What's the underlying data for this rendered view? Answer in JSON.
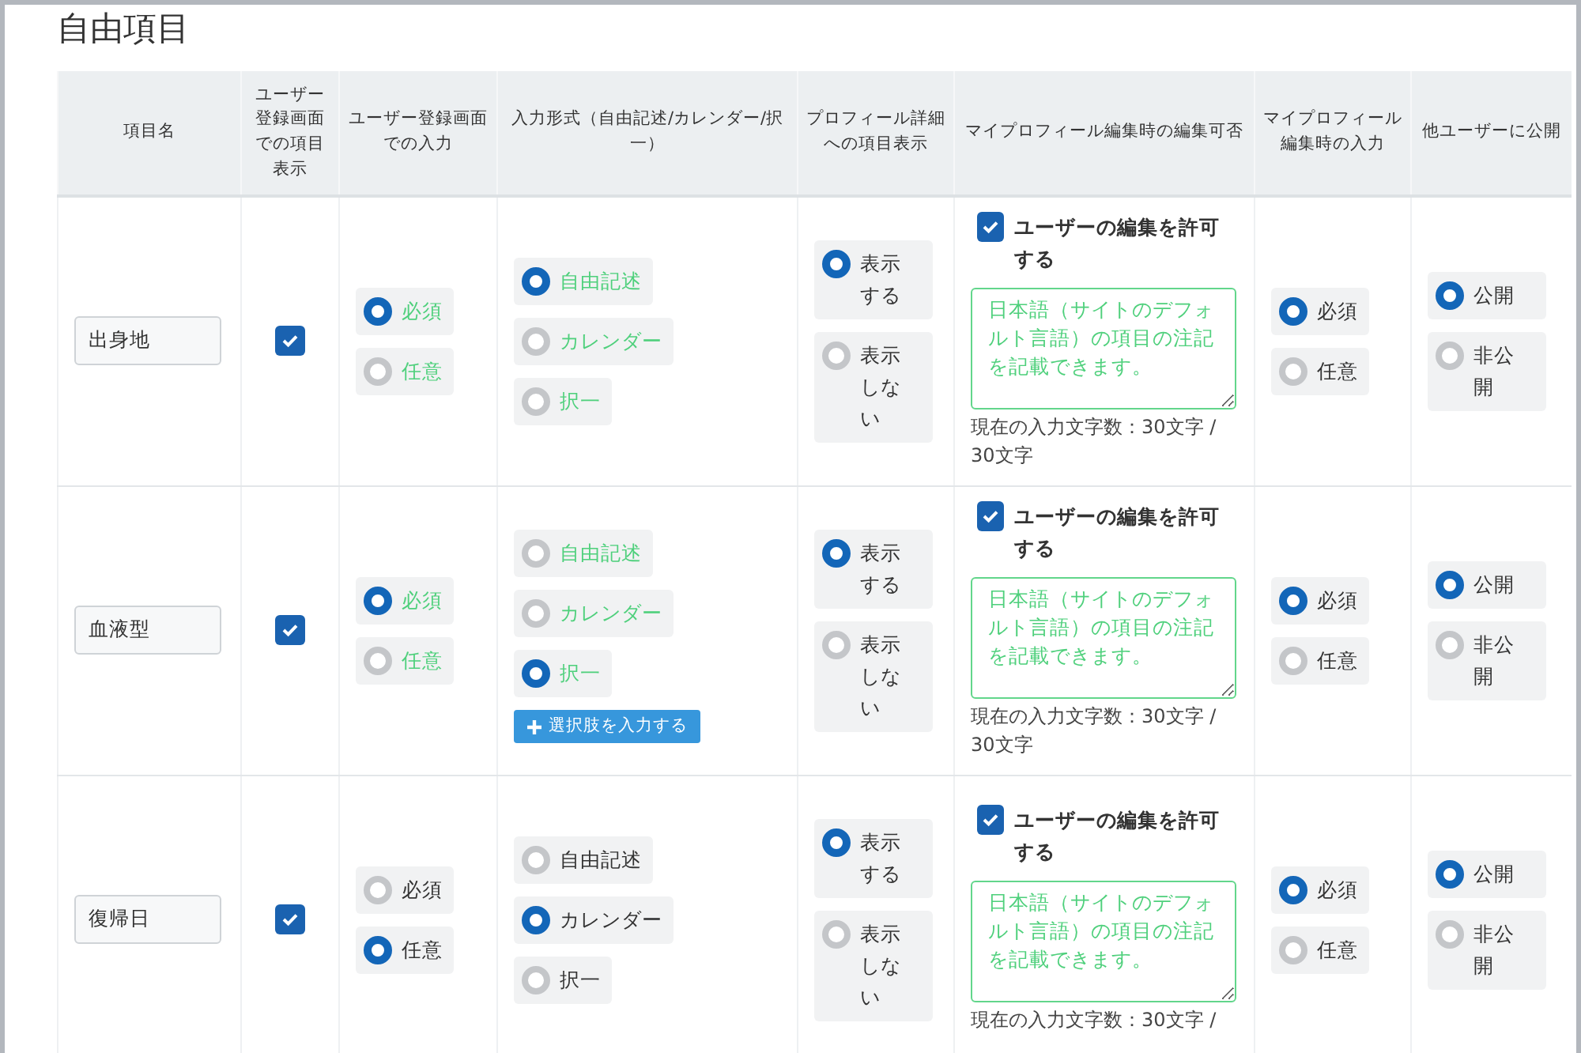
{
  "title": "自由項目",
  "columns": [
    "項目名",
    "ユーザー登録画面での項目表示",
    "ユーザー登録画面での入力",
    "入力形式（自由記述/カレンダー/択一）",
    "プロフィール詳細への項目表示",
    "マイプロフィール編集時の編集可否",
    "マイプロフィール編集時の入力",
    "他ユーザーに公開"
  ],
  "rows": [
    {
      "name": "出身地",
      "show_on_register": true,
      "register_input": {
        "highlighted": true,
        "options": [
          {
            "label": "必須",
            "selected": true
          },
          {
            "label": "任意",
            "selected": false
          }
        ]
      },
      "input_format": {
        "highlighted": true,
        "options": [
          {
            "label": "自由記述",
            "selected": true
          },
          {
            "label": "カレンダー",
            "selected": false
          },
          {
            "label": "択一",
            "selected": false
          }
        ]
      },
      "profile_display": {
        "highlighted": false,
        "options": [
          {
            "label": "表示する",
            "selected": true
          },
          {
            "label": "表示しない",
            "selected": false
          }
        ]
      },
      "edit_permission": {
        "checked": true,
        "label": "ユーザーの編集を許可する",
        "note": "日本語（サイトのデフォルト言語）の項目の注記を記載できます。",
        "char_count": "現在の入力文字数：30文字 / 30文字"
      },
      "profile_input": {
        "highlighted": false,
        "options": [
          {
            "label": "必須",
            "selected": true
          },
          {
            "label": "任意",
            "selected": false
          }
        ]
      },
      "public": {
        "highlighted": false,
        "options": [
          {
            "label": "公開",
            "selected": true
          },
          {
            "label": "非公開",
            "selected": false
          }
        ]
      }
    },
    {
      "name": "血液型",
      "show_on_register": true,
      "register_input": {
        "highlighted": true,
        "options": [
          {
            "label": "必須",
            "selected": true
          },
          {
            "label": "任意",
            "selected": false
          }
        ]
      },
      "input_format": {
        "highlighted": true,
        "options": [
          {
            "label": "自由記述",
            "selected": false
          },
          {
            "label": "カレンダー",
            "selected": false
          },
          {
            "label": "択一",
            "selected": true
          }
        ],
        "add_choices_button": "選択肢を入力する"
      },
      "profile_display": {
        "highlighted": false,
        "options": [
          {
            "label": "表示する",
            "selected": true
          },
          {
            "label": "表示しない",
            "selected": false
          }
        ]
      },
      "edit_permission": {
        "checked": true,
        "label": "ユーザーの編集を許可する",
        "note": "日本語（サイトのデフォルト言語）の項目の注記を記載できます。",
        "char_count": "現在の入力文字数：30文字 / 30文字"
      },
      "profile_input": {
        "highlighted": false,
        "options": [
          {
            "label": "必須",
            "selected": true
          },
          {
            "label": "任意",
            "selected": false
          }
        ]
      },
      "public": {
        "highlighted": false,
        "options": [
          {
            "label": "公開",
            "selected": true
          },
          {
            "label": "非公開",
            "selected": false
          }
        ]
      }
    },
    {
      "name": "復帰日",
      "show_on_register": true,
      "register_input": {
        "highlighted": false,
        "options": [
          {
            "label": "必須",
            "selected": false
          },
          {
            "label": "任意",
            "selected": true
          }
        ]
      },
      "input_format": {
        "highlighted": false,
        "options": [
          {
            "label": "自由記述",
            "selected": false
          },
          {
            "label": "カレンダー",
            "selected": true
          },
          {
            "label": "択一",
            "selected": false
          }
        ]
      },
      "profile_display": {
        "highlighted": false,
        "options": [
          {
            "label": "表示する",
            "selected": true
          },
          {
            "label": "表示しない",
            "selected": false
          }
        ]
      },
      "edit_permission": {
        "checked": true,
        "label": "ユーザーの編集を許可する",
        "note": "日本語（サイトのデフォルト言語）の項目の注記を記載できます。",
        "char_count": "現在の入力文字数：30文字 /"
      },
      "profile_input": {
        "highlighted": false,
        "options": [
          {
            "label": "必須",
            "selected": true
          },
          {
            "label": "任意",
            "selected": false
          }
        ]
      },
      "public": {
        "highlighted": false,
        "options": [
          {
            "label": "公開",
            "selected": true
          },
          {
            "label": "非公開",
            "selected": false
          }
        ]
      }
    }
  ]
}
